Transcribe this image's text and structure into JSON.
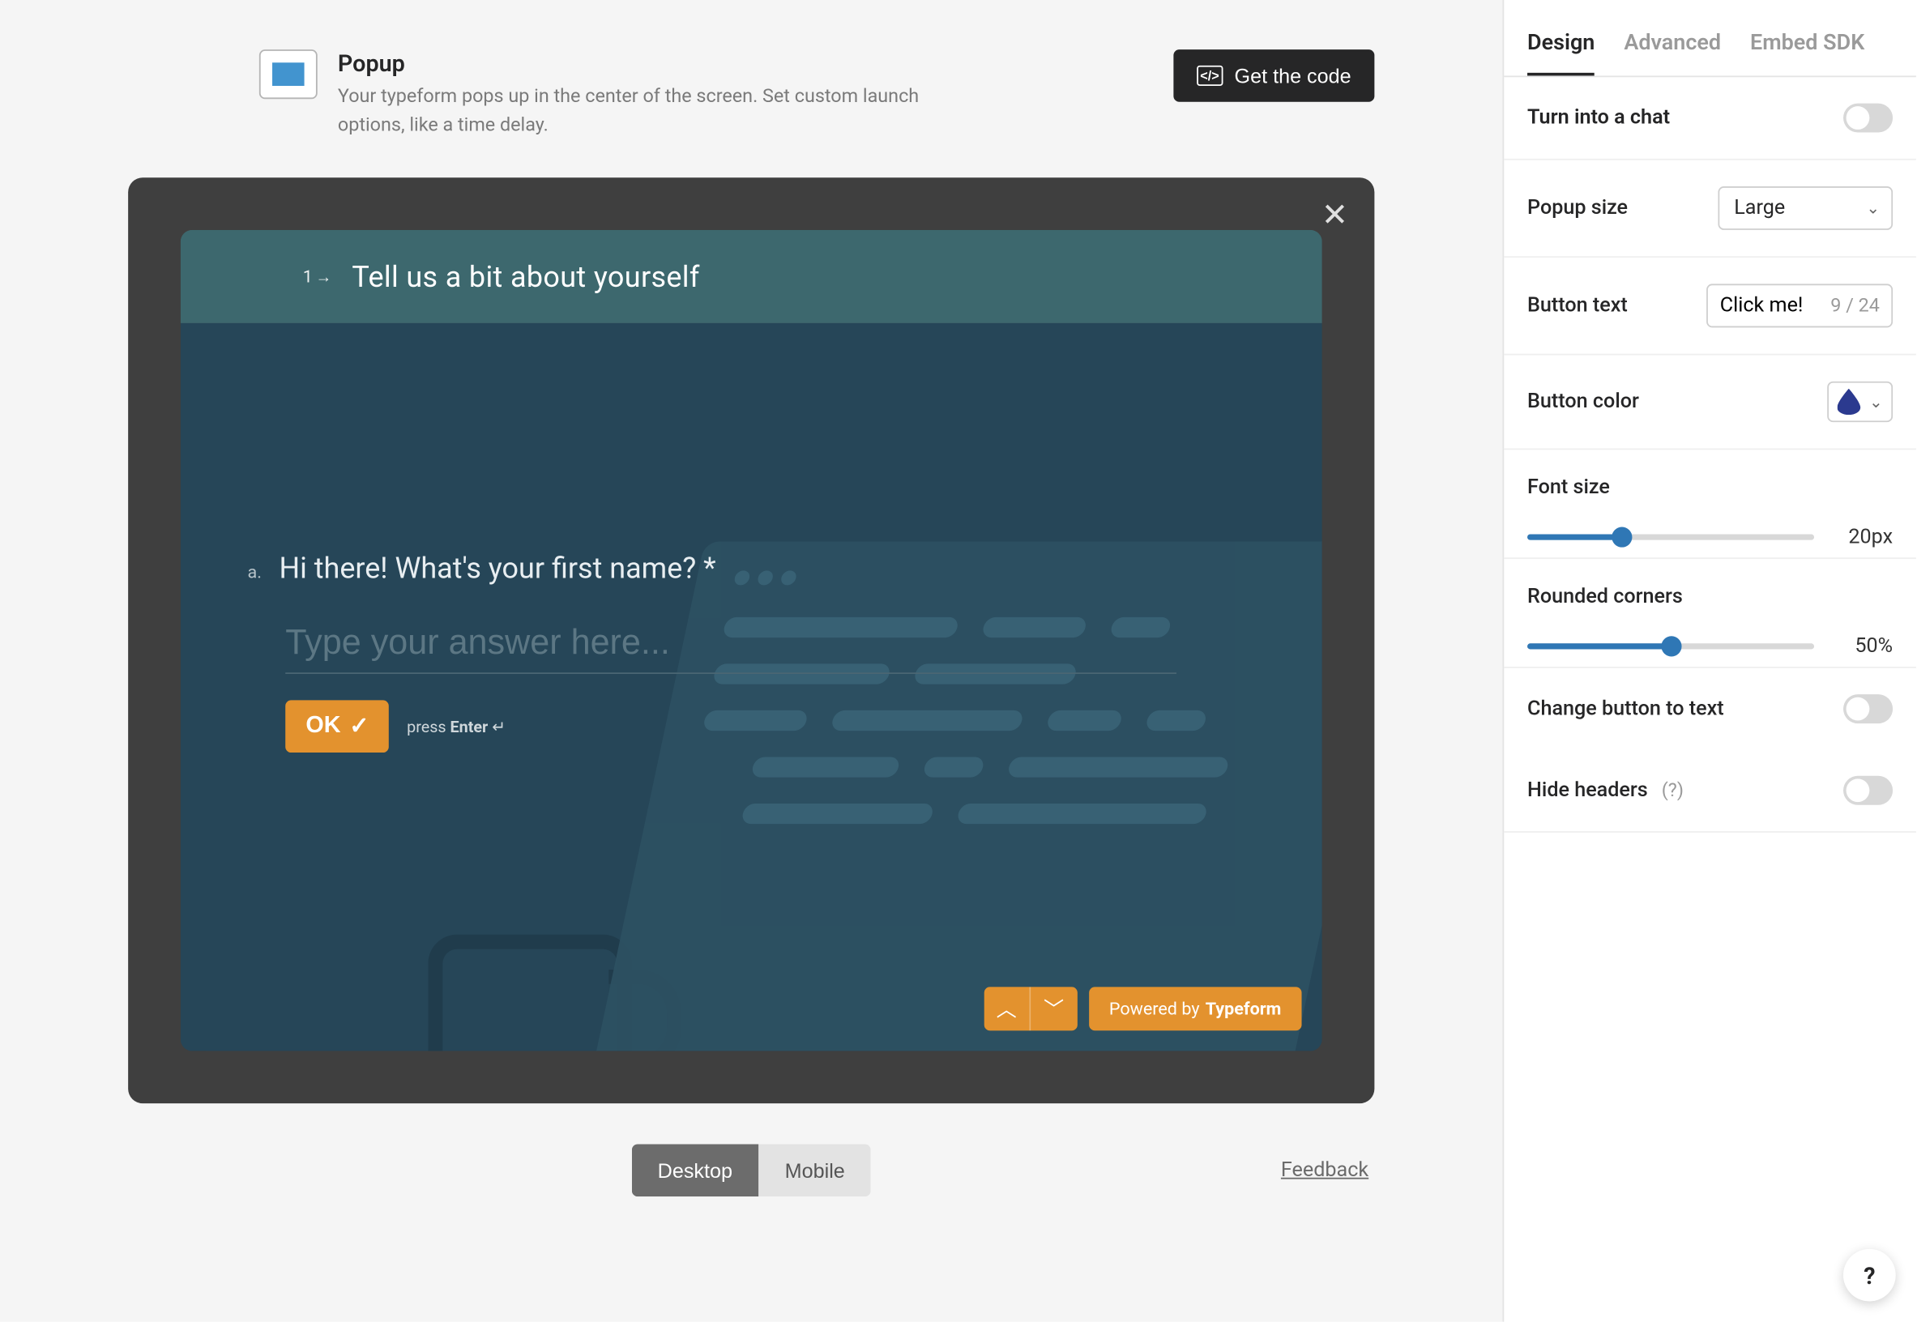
{
  "header": {
    "title": "Popup",
    "description": "Your typeform pops up in the center of the screen. Set custom launch options, like a time delay.",
    "get_code": "Get the code"
  },
  "preview": {
    "question_number": "1",
    "section_title": "Tell us a bit about yourself",
    "question_letter": "a.",
    "question_text": "Hi there! What's your first name? *",
    "placeholder": "Type your answer here...",
    "ok_label": "OK",
    "press_hint_prefix": "press ",
    "press_hint_key": "Enter",
    "press_hint_suffix": " ↵",
    "powered_prefix": "Powered by ",
    "powered_brand": "Typeform"
  },
  "view": {
    "desktop": "Desktop",
    "mobile": "Mobile",
    "feedback": "Feedback"
  },
  "sidebar": {
    "tabs": {
      "design": "Design",
      "advanced": "Advanced",
      "sdk": "Embed SDK"
    },
    "turn_chat": "Turn into a chat",
    "popup_size_label": "Popup size",
    "popup_size_value": "Large",
    "button_text_label": "Button text",
    "button_text_value": "Click me!",
    "button_text_counter": "9 / 24",
    "button_color_label": "Button color",
    "font_size_label": "Font size",
    "font_size_value": "20px",
    "font_size_percent": 33,
    "corners_label": "Rounded corners",
    "corners_value": "50%",
    "corners_percent": 50,
    "change_to_text": "Change button to text",
    "hide_headers": "Hide headers",
    "hide_headers_hint": "(?)",
    "help": "?"
  }
}
